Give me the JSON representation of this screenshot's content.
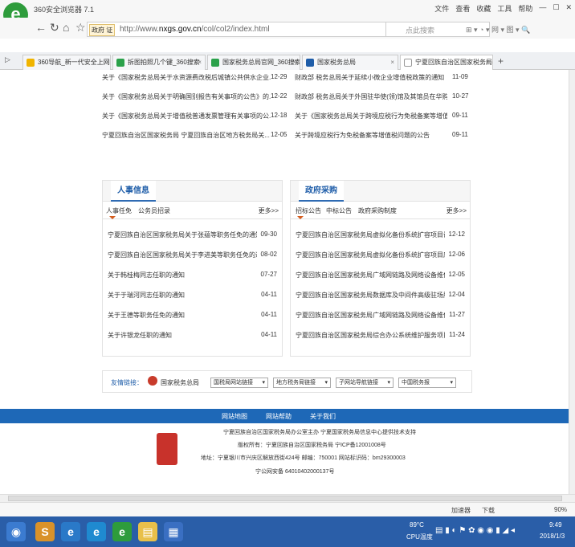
{
  "browser": {
    "title": "360安全浏览器 7.1",
    "window_controls": [
      "文件",
      "查看",
      "收藏",
      "工具",
      "帮助"
    ],
    "address": {
      "prefix": "政府 证",
      "url_start": "http://www.",
      "domain": "nxgs.gov.cn",
      "path": "/col/col2/index.html"
    },
    "search_placeholder": "点此搜索",
    "toolbar_icons": "⊞ ▾ ◔ ▾ 网 ▾ 图 ▾ 🔍"
  },
  "tabs": [
    {
      "label": "360导航_新一代安全上网导航",
      "color": "#f0b400"
    },
    {
      "label": "拆图拍照几个键_360搜索",
      "color": "#2aa14a"
    },
    {
      "label": "国家税务总局官网_360搜索",
      "color": "#2aa14a"
    },
    {
      "label": "国家税务总局",
      "color": "#1d5ca8"
    },
    {
      "label": "宁夏回族自治区国家税务局 信",
      "color": "#999"
    }
  ],
  "news_rows": [
    {
      "left": "关于《国家税务总局关于水资源费改税后城镇公共供水企业...",
      "left_date": "12-29",
      "right": "财政部  税务总局关于延续小微企业增值税政策的通知",
      "right_date": "11-09"
    },
    {
      "left": "关于《国家税务总局关于明确国别报告有关事项的公告》的...",
      "left_date": "12-22",
      "right": "财政部  税务总局关于外国驻华使(领)馆及其馆员在华购...",
      "right_date": "10-27"
    },
    {
      "left": "关于《国家税务总局关于增值税普通发票管理有关事项的公...",
      "left_date": "12-18",
      "right": "关于《国家税务总局关于跨境应税行为免税备案等增值税问...",
      "right_date": "09-11"
    },
    {
      "left": "宁夏回族自治区国家税务局  宁夏回族自治区地方税务局关...",
      "left_date": "12-05",
      "right": "关于跨境应税行为免税备案等增值税问题的公告",
      "right_date": "09-11"
    }
  ],
  "hr_panel": {
    "title": "人事信息",
    "subtabs": [
      "人事任免",
      "公务员招录"
    ],
    "more": "更多>>",
    "items": [
      {
        "title": "宁夏回族自治区国家税务局关于张蕴等职务任免的通知",
        "date": "09-30"
      },
      {
        "title": "宁夏回族自治区国家税务局关于李进美等职务任免的通知",
        "date": "08-02"
      },
      {
        "title": "关于韩桂梅同志任职的通知",
        "date": "07-27"
      },
      {
        "title": "关于于瑞河同志任职的通知",
        "date": "04-11"
      },
      {
        "title": "关于王德等职务任免的通知",
        "date": "04-11"
      },
      {
        "title": "关于许银龙任职的通知",
        "date": "04-11"
      }
    ]
  },
  "procurement_panel": {
    "title": "政府采购",
    "subtabs": [
      "招标公告",
      "中标公告",
      "政府采购制度"
    ],
    "more": "更多>>",
    "items": [
      {
        "title": "宁夏回族自治区国家税务局虚拟化备份系统扩容项目询价公...",
        "date": "12-12"
      },
      {
        "title": "宁夏回族自治区国家税务局虚拟化备份系统扩容项目废标公...",
        "date": "12-06"
      },
      {
        "title": "宁夏回族自治区国家税务局广域网链路及网络设备维保竞...",
        "date": "12-05"
      },
      {
        "title": "宁夏回族自治区国家税务局数据库及中间件高级驻场服务竞...",
        "date": "12-04"
      },
      {
        "title": "宁夏回族自治区国家税务局广域网链路及网络设备维保服...",
        "date": "11-27"
      },
      {
        "title": "宁夏回族自治区国家税务局综合办公系统维护服务项目公...",
        "date": "11-24"
      }
    ]
  },
  "links": {
    "label": "友情链接：",
    "site": "国家税务总局",
    "selects": [
      "国税局网站链接",
      "地方税务局链接",
      "子网站导航链接",
      "中国税务报"
    ]
  },
  "footer_nav": [
    "网站地图",
    "网站帮助",
    "关于我们"
  ],
  "footer": {
    "line1": "宁夏回族自治区国家税务局办公室主办  宁夏国家税务局信息中心提供技术支持",
    "line2": "版权所有：宁夏回族自治区国家税务局  宁ICP备12001008号",
    "line3": "地址：宁夏银川市兴庆区解放西街424号  邮编：750001  网站标识码：bm29300003",
    "line4": "宁公网安备 64010402000137号"
  },
  "status": {
    "accelerator": "加速器",
    "download": "下载",
    "zoom": "90%"
  },
  "tray": {
    "temp": "89°C",
    "cpu": "CPU温度",
    "time": "9:49",
    "date": "2018/1/3"
  }
}
